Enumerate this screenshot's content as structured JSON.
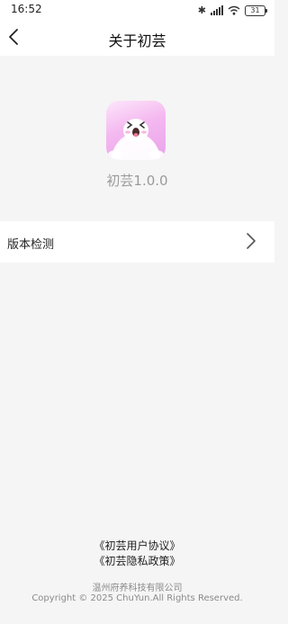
{
  "status_bar": {
    "time": "16:52",
    "battery": "31",
    "icons": [
      "bluetooth-icon",
      "signal-icon",
      "wifi-icon",
      "battery-icon"
    ]
  },
  "header": {
    "title": "关于初芸",
    "back_icon": "chevron-left-icon"
  },
  "about": {
    "app_icon": "ghost-mascot-icon",
    "app_name_version": "初芸1.0.0"
  },
  "settings": {
    "items": [
      {
        "label": "版本检测",
        "icon": "chevron-right-icon"
      }
    ]
  },
  "footer": {
    "user_agreement": "《初芸用户协议》",
    "privacy_policy": "《初芸隐私政策》",
    "company": "温州府养科技有限公司",
    "copyright": "Copyright © 2025 ChuYun.All Rights Reserved."
  },
  "colors": {
    "background": "#f5f5f5",
    "surface": "#ffffff",
    "icon_pink": "#f4b8f0",
    "muted_text": "#9a9a9a"
  }
}
